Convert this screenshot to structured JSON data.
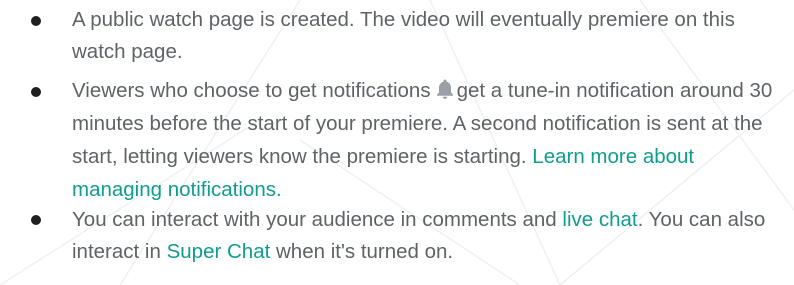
{
  "bullets": {
    "item1": {
      "text": "A public watch page is created. The video will eventually premiere on this watch page."
    },
    "item2": {
      "text_before_icon": "Viewers who choose to get notifications",
      "icon": "bell-icon",
      "text_after_icon": "get a tune-in notification around 30 minutes before the start of your premiere. A second notification is sent at the start, letting viewers know the premiere is starting.",
      "link": "Learn more about managing notifications."
    },
    "item3": {
      "text1": "You can interact with your audience in comments and",
      "link1": "live chat",
      "text2": ". You can also interact in",
      "link2": "Super Chat",
      "text3": "when it's turned on."
    }
  },
  "colors": {
    "text": "#5f6368",
    "link": "#0f9d8f",
    "bullet": "#1f1f1f",
    "bell": "#9aa0a6"
  }
}
